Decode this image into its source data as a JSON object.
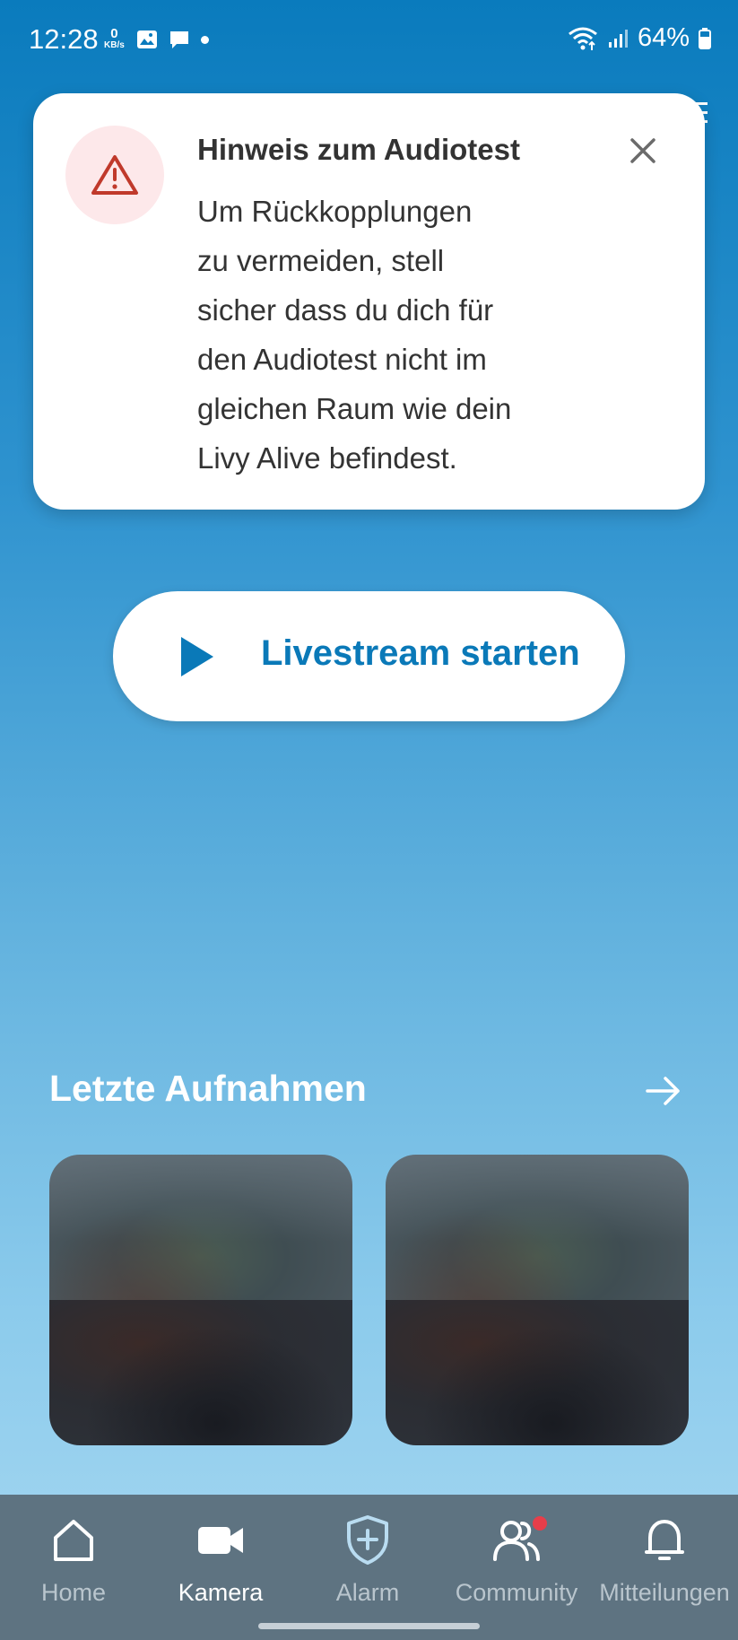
{
  "status_bar": {
    "time": "12:28",
    "kbs_value": "0",
    "kbs_unit": "KB/s",
    "battery": "64%",
    "icons": [
      "image-icon",
      "message-icon",
      "dot-icon",
      "wifi-icon",
      "signal-icon",
      "battery-icon"
    ]
  },
  "dialog": {
    "title": "Hinweis zum Audiotest",
    "lines": [
      "Um Rückkopplungen",
      "zu vermeiden, stell",
      "sicher dass du dich für",
      "den Audiotest nicht im",
      "gleichen Raum wie dein",
      "Livy Alive befindest."
    ],
    "icon": "warning-icon",
    "close_icon": "close-icon"
  },
  "livestream": {
    "label": "Livestream starten",
    "icon": "play-icon"
  },
  "recordings": {
    "title": "Letzte Aufnahmen",
    "arrow_icon": "arrow-right-icon"
  },
  "bottom_nav": {
    "items": [
      {
        "label": "Home",
        "icon": "home-icon",
        "active": false
      },
      {
        "label": "Kamera",
        "icon": "camera-icon",
        "active": true
      },
      {
        "label": "Alarm",
        "icon": "shield-icon",
        "active": false
      },
      {
        "label": "Community",
        "icon": "community-icon",
        "active": false,
        "badge": true
      },
      {
        "label": "Mitteilungen",
        "icon": "bell-icon",
        "active": false
      }
    ]
  },
  "colors": {
    "accent": "#0a79b8",
    "warning": "#c0392b",
    "warning_bg": "#fde8ea",
    "nav_bg": "#5e7381",
    "badge": "#e63e4a"
  }
}
